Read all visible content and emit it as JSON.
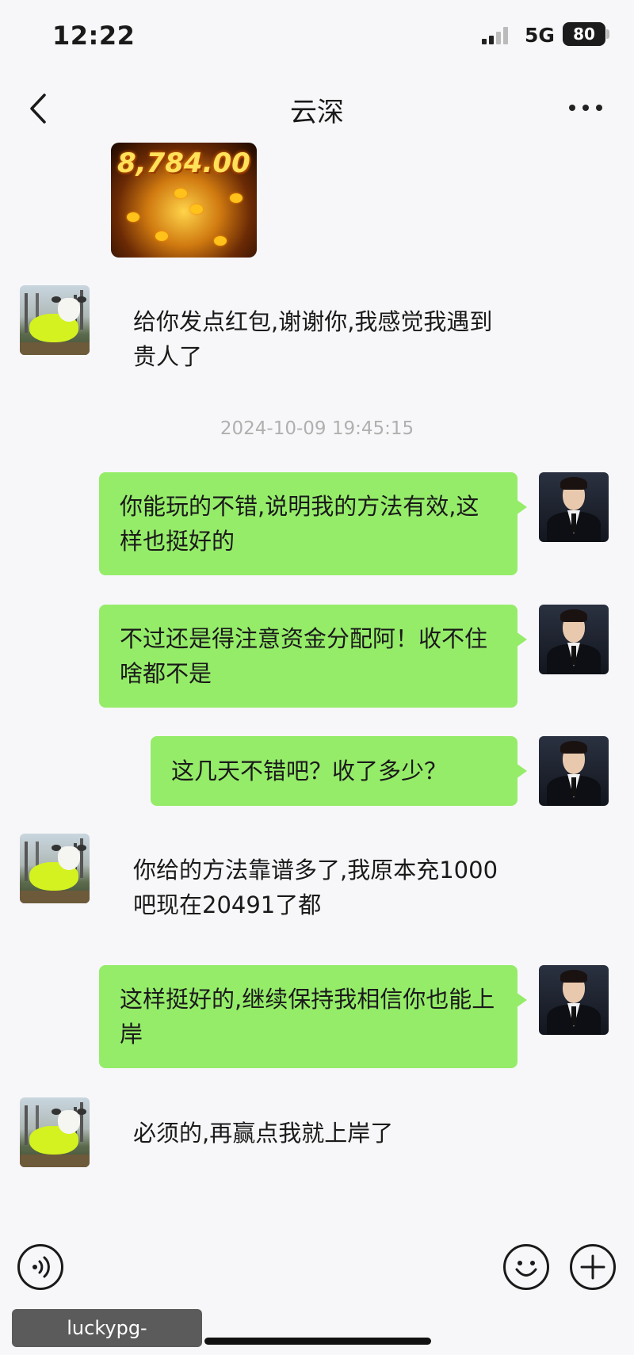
{
  "status_bar": {
    "time": "12:22",
    "network": "5G",
    "battery": "80"
  },
  "header": {
    "title": "云深",
    "back_icon": "chevron-left-icon",
    "more_icon": "more-dots-icon"
  },
  "messages": [
    {
      "side": "in",
      "type": "image",
      "image_text": "8,784.00"
    },
    {
      "side": "in",
      "type": "text",
      "text": "给你发点红包,谢谢你,我感觉我遇到贵人了"
    },
    {
      "side": "system",
      "type": "timestamp",
      "text": "2024-10-09 19:45:15"
    },
    {
      "side": "out",
      "type": "text",
      "text": "你能玩的不错,说明我的方法有效,这样也挺好的"
    },
    {
      "side": "out",
      "type": "text",
      "text": "不过还是得注意资金分配阿！收不住啥都不是"
    },
    {
      "side": "out",
      "type": "text",
      "text": "这几天不错吧？收了多少？"
    },
    {
      "side": "in",
      "type": "text",
      "text": "你给的方法靠谱多了,我原本充1000吧现在20491了都"
    },
    {
      "side": "out",
      "type": "text",
      "text": "这样挺好的,继续保持我相信你也能上岸"
    },
    {
      "side": "in",
      "type": "text",
      "text": "必须的,再赢点我就上岸了"
    }
  ],
  "bottom_bar": {
    "voice_icon": "voice-icon",
    "emoji_icon": "emoji-icon",
    "plus_icon": "plus-icon"
  },
  "watermark": "luckypg-play.com.cn",
  "colors": {
    "outgoing_bubble": "#95ec69",
    "background": "#f7f7f9",
    "timestamp": "#b0b0b0"
  }
}
